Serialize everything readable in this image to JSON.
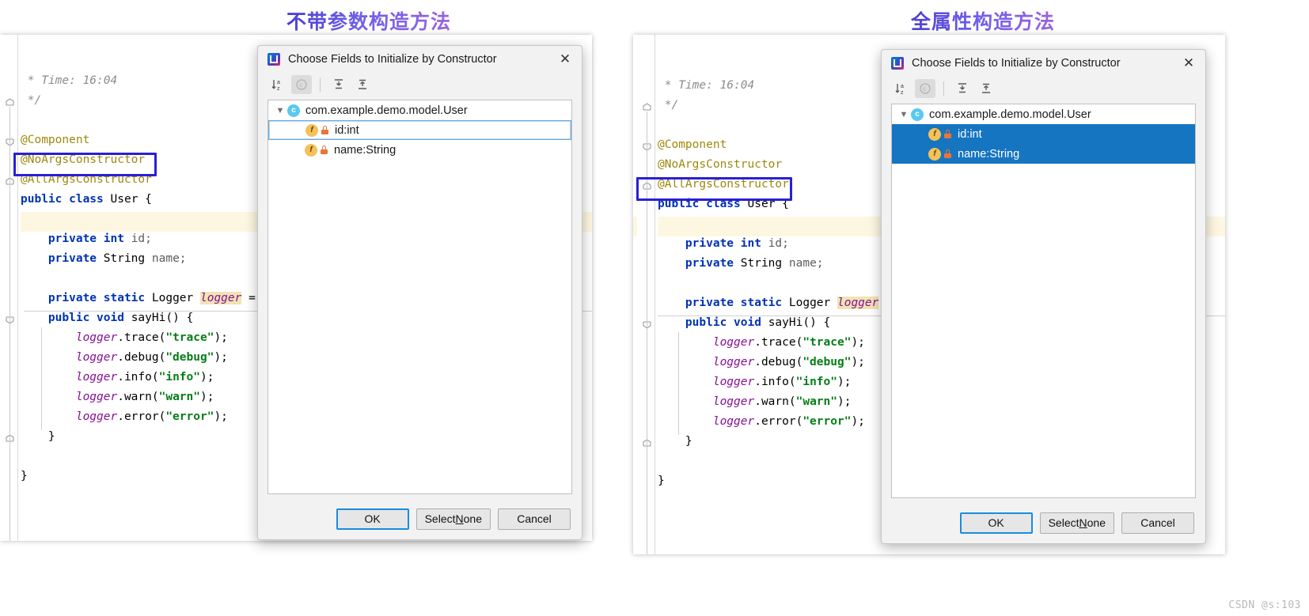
{
  "titles": {
    "left": "不带参数构造方法",
    "right": "全属性构造方法"
  },
  "watermark": "CSDN @s:103",
  "code": {
    "lines": [
      " * Time: 16:04",
      " */",
      "",
      "@Component",
      "@NoArgsConstructor",
      "@AllArgsConstructor",
      "public class User {",
      "",
      "    private int id;",
      "    private String name;",
      "",
      "    private static Logger logger =",
      "    public void sayHi() {",
      "        logger.trace(\"trace\");",
      "        logger.debug(\"debug\");",
      "        logger.info(\"info\");",
      "        logger.warn(\"warn\");",
      "        logger.error(\"error\");",
      "    }",
      "",
      "}"
    ],
    "time_comment": " * Time: 16:04",
    "comment_end": " */",
    "anno_component": "@Component",
    "anno_noargs": "@NoArgsConstructor",
    "anno_allargs": "@AllArgsConstructor",
    "class_decl_kw": "public class ",
    "class_name": "User",
    "class_brace": " {",
    "field_id": "    private int id;",
    "field_name": "    private String name;",
    "logger_field": "    private static Logger logger =",
    "method_sig": "    public void sayHi() {",
    "log_trace": "        logger.trace(\"trace\");",
    "log_debug": "        logger.debug(\"debug\");",
    "log_info": "        logger.info(\"info\");",
    "log_warn": "        logger.warn(\"warn\");",
    "log_error": "        logger.error(\"error\");",
    "close_method": "    }",
    "close_class": "}",
    "highlight_left": "@NoArgsConstructor",
    "highlight_right": "@AllArgsConstructor"
  },
  "dialog": {
    "title": "Choose Fields to Initialize by Constructor",
    "close_label": "✕",
    "toolbar": [
      {
        "name": "sort-alphabetically-icon",
        "label": "↓az"
      },
      {
        "name": "group-by-class-icon",
        "label": "c"
      },
      {
        "name": "expand-all-icon",
        "label": "expand"
      },
      {
        "name": "collapse-all-icon",
        "label": "collapse"
      }
    ],
    "tree": {
      "root": "com.example.demo.model.User",
      "root_icon_letter": "c",
      "items": [
        {
          "label": "id:int",
          "icon_letter": "f"
        },
        {
          "label": "name:String",
          "icon_letter": "f"
        }
      ]
    },
    "buttons": {
      "ok": "OK",
      "select_none_pre": "Select ",
      "select_none_key": "N",
      "select_none_post": "one",
      "cancel": "Cancel"
    }
  },
  "selection": {
    "left_selected": [],
    "left_focused": "id:int",
    "right_selected": [
      "id:int",
      "name:String"
    ]
  },
  "colors": {
    "title_accent": "#4e4ae0",
    "annotation": "#9e880d",
    "keyword": "#0033b3",
    "string": "#067d17",
    "field": "#871094",
    "comment": "#8c8c8c",
    "mark_box": "#2a1fd6",
    "tree_selection": "#1675c0",
    "default_button_border": "#1a8cde"
  }
}
